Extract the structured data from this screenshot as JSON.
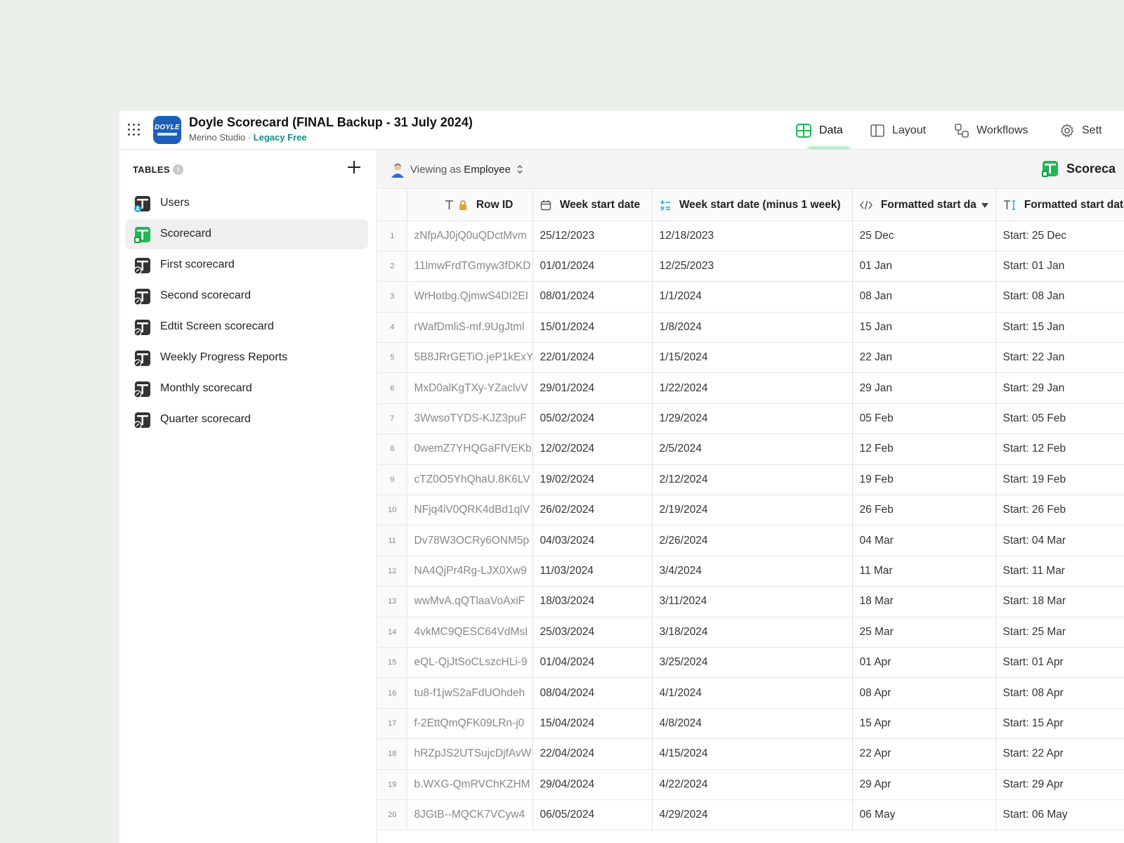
{
  "app": {
    "title": "Doyle Scorecard (FINAL Backup - 31 July 2024)",
    "studio": "Merino Studio",
    "separator": " · ",
    "plan": "Legacy Free",
    "logo_text": "DOYLE"
  },
  "nav": {
    "tabs": [
      {
        "label": "Data",
        "icon": "table-icon",
        "active": true
      },
      {
        "label": "Layout",
        "icon": "layout-icon",
        "active": false
      },
      {
        "label": "Workflows",
        "icon": "workflow-icon",
        "active": false
      },
      {
        "label": "Sett",
        "icon": "gear-icon",
        "active": false
      }
    ]
  },
  "sidebar": {
    "section_label": "TABLES",
    "info_glyph": "i",
    "items": [
      {
        "label": "Users",
        "icon": "users-table-icon"
      },
      {
        "label": "Scorecard",
        "icon": "sheet-table-icon",
        "active": true
      },
      {
        "label": "First scorecard",
        "icon": "query-table-icon"
      },
      {
        "label": "Second scorecard",
        "icon": "query-table-icon"
      },
      {
        "label": "Edtit Screen scorecard",
        "icon": "query-table-icon"
      },
      {
        "label": "Weekly Progress Reports",
        "icon": "query-table-icon"
      },
      {
        "label": "Monthly scorecard",
        "icon": "query-table-icon"
      },
      {
        "label": "Quarter scorecard",
        "icon": "query-table-icon"
      }
    ]
  },
  "toolbar": {
    "viewing_prefix": "Viewing as",
    "viewing_role": "Employee",
    "table_badge": "Scoreca"
  },
  "table": {
    "columns": [
      {
        "label": "Row ID",
        "icon": "text-lock-icon"
      },
      {
        "label": "Week start date",
        "icon": "calendar-icon"
      },
      {
        "label": "Week start date (minus 1 week)",
        "icon": "math-icon"
      },
      {
        "label": "Formatted start da",
        "icon": "code-icon"
      },
      {
        "label": "Formatted start dat",
        "icon": "text-template-icon"
      }
    ],
    "rows": [
      {
        "n": "1",
        "id": "zNfpAJ0jQ0uQDctMvm",
        "week": "25/12/2023",
        "minus": "12/18/2023",
        "fmt": "25 Dec",
        "fmt2": "Start: 25 Dec"
      },
      {
        "n": "2",
        "id": "11lmwFrdTGmyw3fDKD",
        "week": "01/01/2024",
        "minus": "12/25/2023",
        "fmt": "01 Jan",
        "fmt2": "Start: 01 Jan"
      },
      {
        "n": "3",
        "id": "WrHotbg.QjmwS4DI2EI",
        "week": "08/01/2024",
        "minus": "1/1/2024",
        "fmt": "08 Jan",
        "fmt2": "Start: 08 Jan"
      },
      {
        "n": "4",
        "id": "rWafDmliS-mf.9UgJtml",
        "week": "15/01/2024",
        "minus": "1/8/2024",
        "fmt": "15 Jan",
        "fmt2": "Start: 15 Jan"
      },
      {
        "n": "5",
        "id": "5B8JRrGETiO.jeP1kExY",
        "week": "22/01/2024",
        "minus": "1/15/2024",
        "fmt": "22 Jan",
        "fmt2": "Start: 22 Jan"
      },
      {
        "n": "6",
        "id": "MxD0alKgTXy-YZaclvV",
        "week": "29/01/2024",
        "minus": "1/22/2024",
        "fmt": "29 Jan",
        "fmt2": "Start: 29 Jan"
      },
      {
        "n": "7",
        "id": "3WwsoTYDS-KJZ3puF",
        "week": "05/02/2024",
        "minus": "1/29/2024",
        "fmt": "05 Feb",
        "fmt2": "Start: 05 Feb"
      },
      {
        "n": "8",
        "id": "0wemZ7YHQGaFfVEKb",
        "week": "12/02/2024",
        "minus": "2/5/2024",
        "fmt": "12 Feb",
        "fmt2": "Start: 12 Feb"
      },
      {
        "n": "9",
        "id": "cTZ0O5YhQhaU.8K6LV",
        "week": "19/02/2024",
        "minus": "2/12/2024",
        "fmt": "19 Feb",
        "fmt2": "Start: 19 Feb"
      },
      {
        "n": "10",
        "id": "NFjq4iV0QRK4dBd1qlV",
        "week": "26/02/2024",
        "minus": "2/19/2024",
        "fmt": "26 Feb",
        "fmt2": "Start: 26 Feb"
      },
      {
        "n": "11",
        "id": "Dv78W3OCRy6ONM5p",
        "week": "04/03/2024",
        "minus": "2/26/2024",
        "fmt": "04 Mar",
        "fmt2": "Start: 04 Mar"
      },
      {
        "n": "12",
        "id": "NA4QjPr4Rg-LJX0Xw9",
        "week": "11/03/2024",
        "minus": "3/4/2024",
        "fmt": "11 Mar",
        "fmt2": "Start: 11 Mar"
      },
      {
        "n": "13",
        "id": "wwMvA.qQTlaaVoAxiF",
        "week": "18/03/2024",
        "minus": "3/11/2024",
        "fmt": "18 Mar",
        "fmt2": "Start: 18 Mar"
      },
      {
        "n": "14",
        "id": "4vkMC9QESC64VdMsI",
        "week": "25/03/2024",
        "minus": "3/18/2024",
        "fmt": "25 Mar",
        "fmt2": "Start: 25 Mar"
      },
      {
        "n": "15",
        "id": "eQL-QjJtSoCLszcHLi-9",
        "week": "01/04/2024",
        "minus": "3/25/2024",
        "fmt": "01 Apr",
        "fmt2": "Start: 01 Apr"
      },
      {
        "n": "16",
        "id": "tu8-f1jwS2aFdUOhdeh",
        "week": "08/04/2024",
        "minus": "4/1/2024",
        "fmt": "08 Apr",
        "fmt2": "Start: 08 Apr"
      },
      {
        "n": "17",
        "id": "f-2EttQmQFK09LRn-j0",
        "week": "15/04/2024",
        "minus": "4/8/2024",
        "fmt": "15 Apr",
        "fmt2": "Start: 15 Apr"
      },
      {
        "n": "18",
        "id": "hRZpJS2UTSujcDjfAvW",
        "week": "22/04/2024",
        "minus": "4/15/2024",
        "fmt": "22 Apr",
        "fmt2": "Start: 22 Apr"
      },
      {
        "n": "19",
        "id": "b.WXG-QmRVChKZHM",
        "week": "29/04/2024",
        "minus": "4/22/2024",
        "fmt": "29 Apr",
        "fmt2": "Start: 29 Apr"
      },
      {
        "n": "20",
        "id": "8JGtB--MQCK7VCyw4",
        "week": "06/05/2024",
        "minus": "4/29/2024",
        "fmt": "06 May",
        "fmt2": "Start: 06 May"
      }
    ]
  },
  "colors": {
    "accent_green": "#1db954",
    "plan_teal": "#0c8f8a",
    "logo_blue": "#1d5fb8"
  }
}
